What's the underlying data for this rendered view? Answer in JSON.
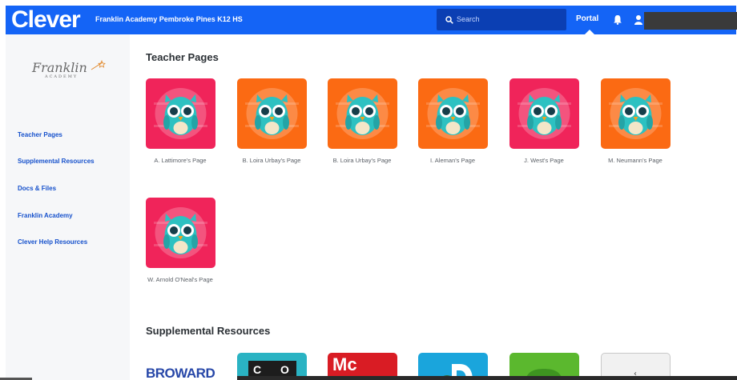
{
  "header": {
    "brand": "Clever",
    "district": "Franklin Academy Pembroke Pines K12 HS",
    "search_placeholder": "Search",
    "portal_label": "Portal",
    "icons": [
      "search-icon",
      "bell-icon",
      "user-icon"
    ],
    "accent_color": "#1464f6"
  },
  "sidebar": {
    "logo_text": "Franklin",
    "logo_subtext": "ACADEMY",
    "items": [
      {
        "label": "Teacher Pages"
      },
      {
        "label": "Supplemental Resources"
      },
      {
        "label": "Docs & Files"
      },
      {
        "label": "Franklin Academy"
      },
      {
        "label": "Clever Help Resources"
      }
    ]
  },
  "main": {
    "teacher_section_title": "Teacher Pages",
    "teacher_pages": [
      {
        "label": "A. Lattimore's Page",
        "icon": "owl-icon",
        "bg": "#f0245a"
      },
      {
        "label": "B. Loira Urbay's Page",
        "icon": "owl-icon",
        "bg": "#fb6a13"
      },
      {
        "label": "B. Loira Urbay's Page",
        "icon": "owl-icon",
        "bg": "#fb6a13"
      },
      {
        "label": "I. Aleman's Page",
        "icon": "owl-icon",
        "bg": "#fb6a13"
      },
      {
        "label": "J. West's Page",
        "icon": "owl-icon",
        "bg": "#f0245a"
      },
      {
        "label": "M. Neumann's Page",
        "icon": "owl-icon",
        "bg": "#fb6a13"
      },
      {
        "label": "W. Arnold O'Neal's Page",
        "icon": "owl-icon",
        "bg": "#f0245a"
      }
    ],
    "supplemental_section_title": "Supplemental Resources",
    "supplemental_resources": [
      {
        "text": "BROWARD"
      },
      {
        "text": "C O"
      },
      {
        "text": "Mc"
      },
      {
        "text": ""
      },
      {
        "text": ""
      },
      {
        "text": ""
      }
    ]
  }
}
